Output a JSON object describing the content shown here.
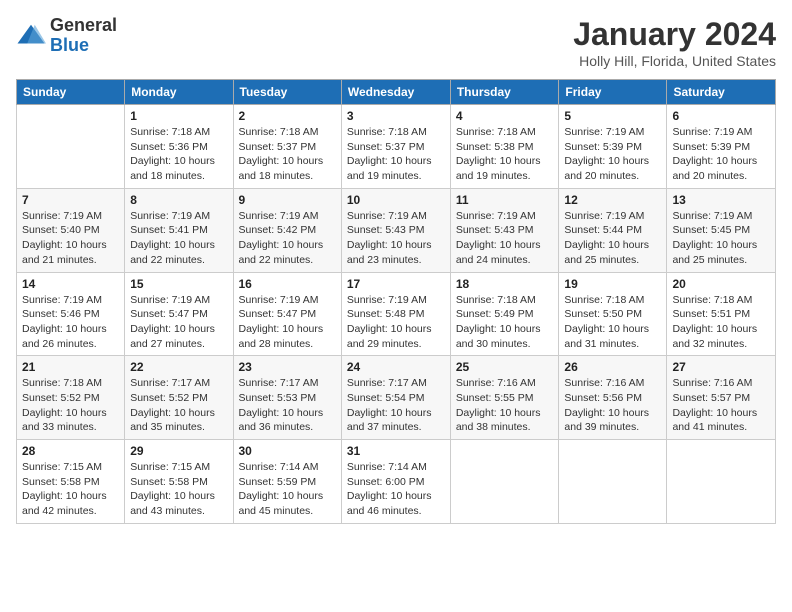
{
  "logo": {
    "general": "General",
    "blue": "Blue"
  },
  "title": "January 2024",
  "location": "Holly Hill, Florida, United States",
  "days_of_week": [
    "Sunday",
    "Monday",
    "Tuesday",
    "Wednesday",
    "Thursday",
    "Friday",
    "Saturday"
  ],
  "weeks": [
    [
      {
        "day": "",
        "info": ""
      },
      {
        "day": "1",
        "info": "Sunrise: 7:18 AM\nSunset: 5:36 PM\nDaylight: 10 hours\nand 18 minutes."
      },
      {
        "day": "2",
        "info": "Sunrise: 7:18 AM\nSunset: 5:37 PM\nDaylight: 10 hours\nand 18 minutes."
      },
      {
        "day": "3",
        "info": "Sunrise: 7:18 AM\nSunset: 5:37 PM\nDaylight: 10 hours\nand 19 minutes."
      },
      {
        "day": "4",
        "info": "Sunrise: 7:18 AM\nSunset: 5:38 PM\nDaylight: 10 hours\nand 19 minutes."
      },
      {
        "day": "5",
        "info": "Sunrise: 7:19 AM\nSunset: 5:39 PM\nDaylight: 10 hours\nand 20 minutes."
      },
      {
        "day": "6",
        "info": "Sunrise: 7:19 AM\nSunset: 5:39 PM\nDaylight: 10 hours\nand 20 minutes."
      }
    ],
    [
      {
        "day": "7",
        "info": "Sunrise: 7:19 AM\nSunset: 5:40 PM\nDaylight: 10 hours\nand 21 minutes."
      },
      {
        "day": "8",
        "info": "Sunrise: 7:19 AM\nSunset: 5:41 PM\nDaylight: 10 hours\nand 22 minutes."
      },
      {
        "day": "9",
        "info": "Sunrise: 7:19 AM\nSunset: 5:42 PM\nDaylight: 10 hours\nand 22 minutes."
      },
      {
        "day": "10",
        "info": "Sunrise: 7:19 AM\nSunset: 5:43 PM\nDaylight: 10 hours\nand 23 minutes."
      },
      {
        "day": "11",
        "info": "Sunrise: 7:19 AM\nSunset: 5:43 PM\nDaylight: 10 hours\nand 24 minutes."
      },
      {
        "day": "12",
        "info": "Sunrise: 7:19 AM\nSunset: 5:44 PM\nDaylight: 10 hours\nand 25 minutes."
      },
      {
        "day": "13",
        "info": "Sunrise: 7:19 AM\nSunset: 5:45 PM\nDaylight: 10 hours\nand 25 minutes."
      }
    ],
    [
      {
        "day": "14",
        "info": "Sunrise: 7:19 AM\nSunset: 5:46 PM\nDaylight: 10 hours\nand 26 minutes."
      },
      {
        "day": "15",
        "info": "Sunrise: 7:19 AM\nSunset: 5:47 PM\nDaylight: 10 hours\nand 27 minutes."
      },
      {
        "day": "16",
        "info": "Sunrise: 7:19 AM\nSunset: 5:47 PM\nDaylight: 10 hours\nand 28 minutes."
      },
      {
        "day": "17",
        "info": "Sunrise: 7:19 AM\nSunset: 5:48 PM\nDaylight: 10 hours\nand 29 minutes."
      },
      {
        "day": "18",
        "info": "Sunrise: 7:18 AM\nSunset: 5:49 PM\nDaylight: 10 hours\nand 30 minutes."
      },
      {
        "day": "19",
        "info": "Sunrise: 7:18 AM\nSunset: 5:50 PM\nDaylight: 10 hours\nand 31 minutes."
      },
      {
        "day": "20",
        "info": "Sunrise: 7:18 AM\nSunset: 5:51 PM\nDaylight: 10 hours\nand 32 minutes."
      }
    ],
    [
      {
        "day": "21",
        "info": "Sunrise: 7:18 AM\nSunset: 5:52 PM\nDaylight: 10 hours\nand 33 minutes."
      },
      {
        "day": "22",
        "info": "Sunrise: 7:17 AM\nSunset: 5:52 PM\nDaylight: 10 hours\nand 35 minutes."
      },
      {
        "day": "23",
        "info": "Sunrise: 7:17 AM\nSunset: 5:53 PM\nDaylight: 10 hours\nand 36 minutes."
      },
      {
        "day": "24",
        "info": "Sunrise: 7:17 AM\nSunset: 5:54 PM\nDaylight: 10 hours\nand 37 minutes."
      },
      {
        "day": "25",
        "info": "Sunrise: 7:16 AM\nSunset: 5:55 PM\nDaylight: 10 hours\nand 38 minutes."
      },
      {
        "day": "26",
        "info": "Sunrise: 7:16 AM\nSunset: 5:56 PM\nDaylight: 10 hours\nand 39 minutes."
      },
      {
        "day": "27",
        "info": "Sunrise: 7:16 AM\nSunset: 5:57 PM\nDaylight: 10 hours\nand 41 minutes."
      }
    ],
    [
      {
        "day": "28",
        "info": "Sunrise: 7:15 AM\nSunset: 5:58 PM\nDaylight: 10 hours\nand 42 minutes."
      },
      {
        "day": "29",
        "info": "Sunrise: 7:15 AM\nSunset: 5:58 PM\nDaylight: 10 hours\nand 43 minutes."
      },
      {
        "day": "30",
        "info": "Sunrise: 7:14 AM\nSunset: 5:59 PM\nDaylight: 10 hours\nand 45 minutes."
      },
      {
        "day": "31",
        "info": "Sunrise: 7:14 AM\nSunset: 6:00 PM\nDaylight: 10 hours\nand 46 minutes."
      },
      {
        "day": "",
        "info": ""
      },
      {
        "day": "",
        "info": ""
      },
      {
        "day": "",
        "info": ""
      }
    ]
  ]
}
